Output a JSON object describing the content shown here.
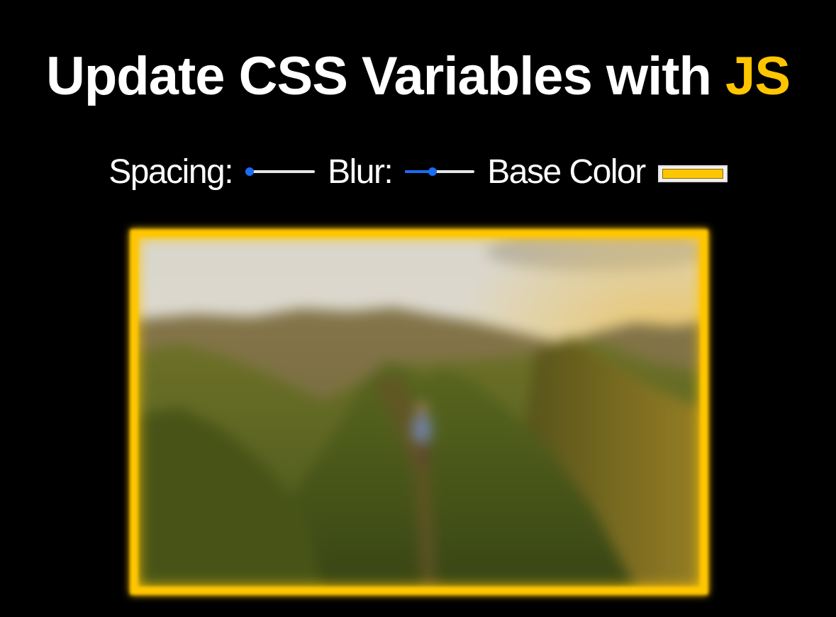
{
  "header": {
    "title_main": "Update CSS Variables with ",
    "title_highlight": "JS"
  },
  "controls": {
    "spacing": {
      "label": "Spacing:",
      "value": 10,
      "min": 10,
      "max": 200
    },
    "blur": {
      "label": "Blur:",
      "value": 10,
      "min": 0,
      "max": 25
    },
    "base_color": {
      "label": "Base Color",
      "value": "#ffc600"
    }
  },
  "photo": {
    "description_icon": "mountain-ridge-image"
  },
  "colors": {
    "background": "#000000",
    "text": "#ffffff",
    "accent": "#ffc600",
    "slider_fill": "#1a6cf0",
    "slider_track": "#e6e6e6"
  }
}
